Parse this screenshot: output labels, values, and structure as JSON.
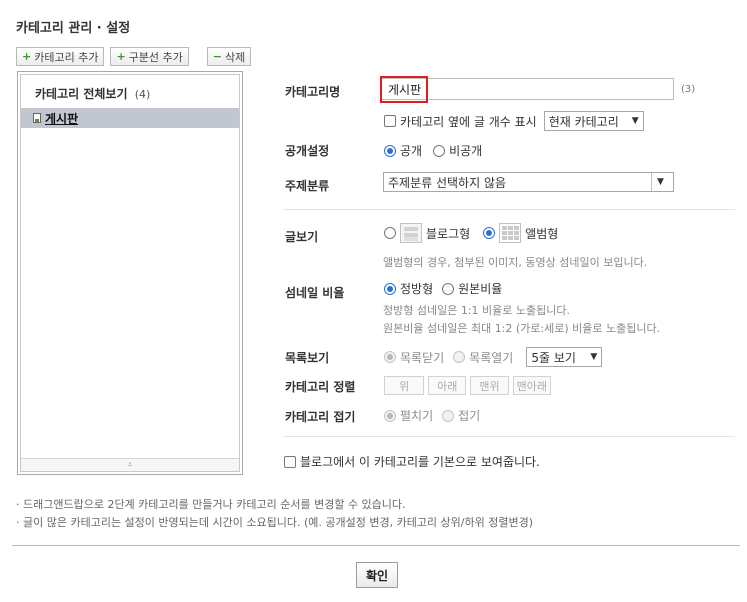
{
  "page": {
    "title": "카테고리 관리 · 설정"
  },
  "toolbar": {
    "add_category": "카테고리 추가",
    "add_divider": "구분선 추가",
    "delete": "삭제",
    "plus_glyph": "+",
    "minus_glyph": "−"
  },
  "tree": {
    "all_label": "카테고리 전체보기",
    "all_count": "(4)",
    "selected_item": "게시판",
    "grip": "⩡"
  },
  "form": {
    "name": {
      "label": "카테고리명",
      "value": "게시판",
      "count": "(3)"
    },
    "show_count": {
      "label": "카테고리 옆에 글 개수 표시",
      "checked": false,
      "select_value": "현재 카테고리"
    },
    "visibility": {
      "label": "공개설정",
      "options": [
        "공개",
        "비공개"
      ],
      "selected": "공개"
    },
    "topic": {
      "label": "주제분류",
      "value": "주제분류 선택하지 않음"
    },
    "view": {
      "label": "글보기",
      "options": [
        "블로그형",
        "앨범형"
      ],
      "selected": "앨범형",
      "help": "앨범형의 경우, 첨부된 이미지, 동영상 섬네일이 보입니다."
    },
    "thumb_ratio": {
      "label": "섬네일 비율",
      "options": [
        "정방형",
        "원본비율"
      ],
      "selected": "정방형",
      "help1": "정방형 섬네일은 1:1 비율로 노출됩니다.",
      "help2": "원본비율 섬네일은 최대 1:2 (가로:세로) 비율로 노출됩니다."
    },
    "list_view": {
      "label": "목록보기",
      "options": [
        "목록닫기",
        "목록열기"
      ],
      "selected": "목록닫기",
      "rows_select": "5줄 보기"
    },
    "order": {
      "label": "카테고리 정렬",
      "buttons": [
        "위",
        "아래",
        "맨위",
        "맨아래"
      ]
    },
    "fold": {
      "label": "카테고리 접기",
      "options": [
        "펼치기",
        "접기"
      ],
      "selected": "펼치기"
    },
    "default_view": {
      "label": "블로그에서 이 카테고리를 기본으로 보여줍니다.",
      "checked": false
    }
  },
  "footnotes": [
    "· 드래그앤드랍으로 2단계 카테고리를 만들거나 카테고리 순서를 변경할 수 있습니다.",
    "· 글이 많은 카테고리는 설정이 반영되는데 시간이 소요됩니다. (예. 공개설정 변경, 카테고리 상위/하위 정렬변경)"
  ],
  "confirm": {
    "label": "확인"
  },
  "icons": {
    "dropdown": "▼"
  },
  "colors": {
    "accent_blue": "#2a6fd1",
    "highlight_red": "#e01c1c",
    "selection_bg": "#c1c6cf"
  }
}
